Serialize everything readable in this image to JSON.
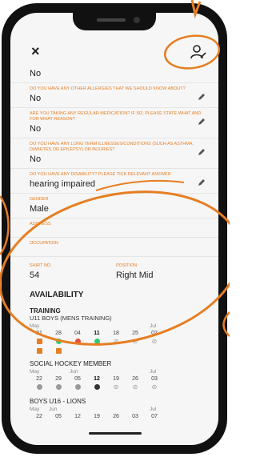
{
  "topbar": {
    "close_icon": "×"
  },
  "fields": [
    {
      "question": "",
      "answer": "No"
    },
    {
      "question": "DO YOU HAVE ANY OTHER ALLERGIES THAT WE SHOULD KNOW ABOUT?",
      "answer": "No"
    },
    {
      "question": "ARE YOU TAKING ANY REGULAR MEDICATION? IF SO, PLEASE STATE WHAT AND FOR WHAT REASON?",
      "answer": "No"
    },
    {
      "question": "DO YOU HAVE ANY LONG TERM ILLNESSES/CONDITIONS (SUCH AS ASTHMA, DIABETES OR EPILEPSY) OR INJURIES?",
      "answer": "No"
    },
    {
      "question": "DO YOU HAVE ANY DISABILITY? PLEASE TICK RELEVANT ANSWER",
      "answer": "hearing impaired"
    },
    {
      "question": "GENDER",
      "answer": "Male"
    },
    {
      "question": "ADDRESS",
      "answer": ""
    },
    {
      "question": "OCCUPATION",
      "answer": ""
    }
  ],
  "shirt": {
    "label": "SHIRT NO.",
    "value": "54"
  },
  "position": {
    "label": "POSITION",
    "value": "Right Mid"
  },
  "availability": {
    "title": "AVAILABILITY",
    "training": {
      "title": "TRAINING",
      "team": "U11 BOYS (MENS TRAINING)",
      "months": [
        "May",
        "Jul"
      ],
      "days": [
        "21",
        "28",
        "04",
        "11",
        "18",
        "25",
        "02"
      ]
    },
    "social": {
      "title": "SOCIAL HOCKEY MEMBER",
      "months": [
        "May",
        "Jun",
        "Jul"
      ],
      "days": [
        "22",
        "29",
        "05",
        "12",
        "19",
        "26",
        "03"
      ]
    },
    "boys": {
      "title": "BOYS U16 - LIONS",
      "months": [
        "May",
        "Jun",
        "Jul"
      ],
      "days": [
        "22",
        "05",
        "12",
        "19",
        "26",
        "03",
        "07"
      ]
    }
  },
  "colors": {
    "accent": "#e67e22",
    "yes": "#2ecc71",
    "no": "#e74c3c"
  }
}
